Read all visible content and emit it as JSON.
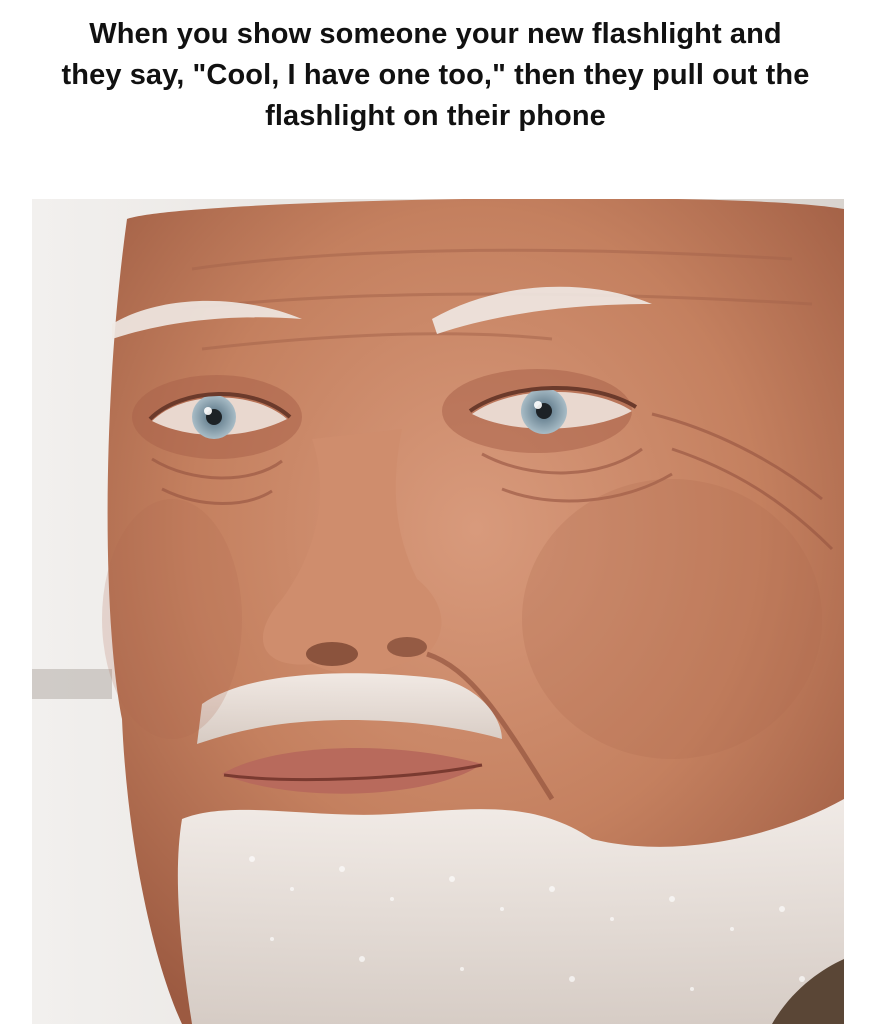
{
  "meme": {
    "caption": "When you show someone your new flashlight and they say, \"Cool, I have one too,\" then they pull out the flashlight on their phone"
  },
  "photo": {
    "subject": "close-up of an elderly man's face with a pained, forced expression",
    "colors": {
      "skin": "#c98a6e",
      "skin_shadow": "#9a5a44",
      "beard": "#eeeae6",
      "eyes": "#8fa6b4",
      "background": "#e9e6e3"
    }
  }
}
